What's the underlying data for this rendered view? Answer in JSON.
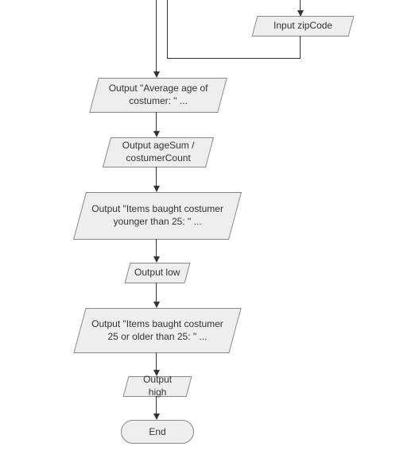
{
  "shapes": {
    "inputZip": "Input zipCode",
    "outAvgLabel": "Output \"Average age of  costumer: \" ...",
    "outAvgCalc": "Output ageSum / costumerCount",
    "outYoungLabel": "Output \"Items baught costumer younger than 25: \" ...",
    "outLow": "Output low",
    "outOldLabel": "Output \"Items baught costumer 25 or older than 25: \" ...",
    "outHigh": "Output high",
    "end": "End"
  }
}
